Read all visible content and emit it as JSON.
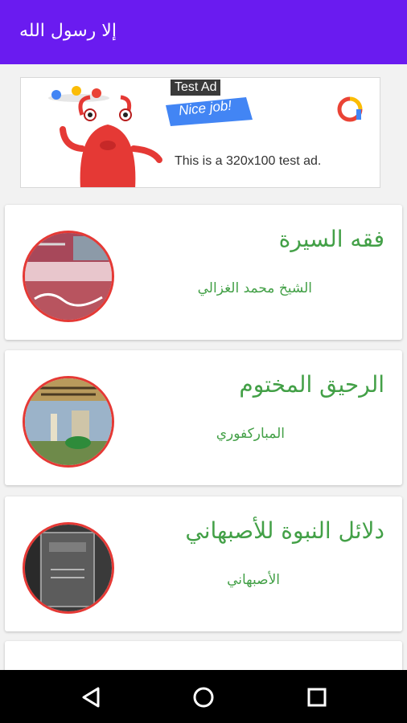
{
  "app": {
    "title": "إلا رسول الله"
  },
  "ad": {
    "badge": "Test Ad",
    "banner": "Nice job!",
    "text": "This is a 320x100 test ad."
  },
  "books": [
    {
      "title": "فقه السيرة",
      "author": "الشيخ محمد الغزالي"
    },
    {
      "title": "الرحيق المختوم",
      "author": "المباركفوري"
    },
    {
      "title": "دلائل النبوة للأصبهاني",
      "author": "الأصبهاني"
    }
  ],
  "colors": {
    "appbar": "#6a1bf0",
    "text_green": "#43a047",
    "cover_border": "#e53935"
  },
  "nav": {
    "icons": [
      "back-icon",
      "home-icon",
      "recents-icon"
    ]
  }
}
